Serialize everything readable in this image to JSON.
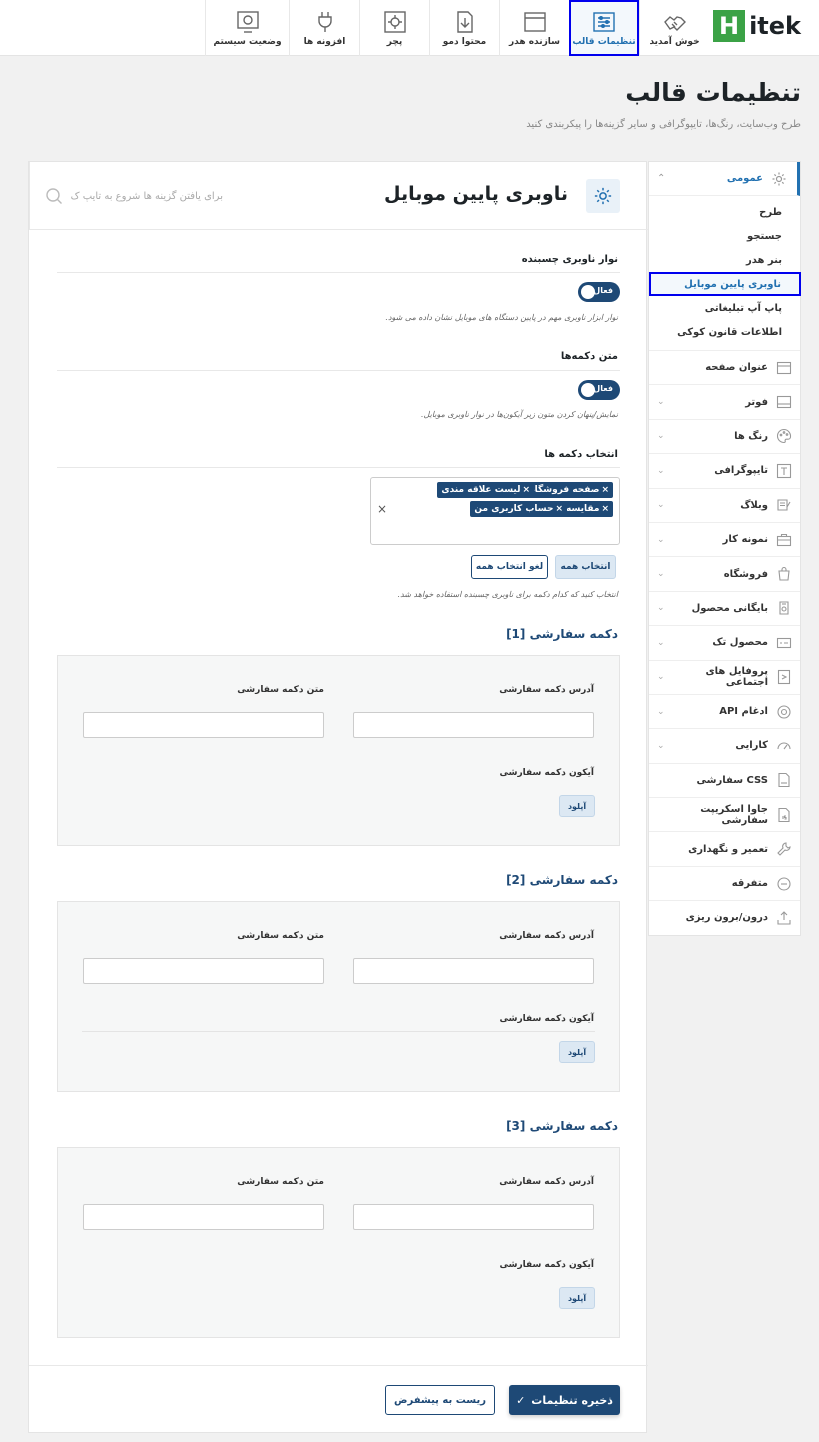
{
  "logo": {
    "letter": "H",
    "text": "itek"
  },
  "topnav": [
    {
      "label": "خوش آمدید",
      "icon": "handshake-icon"
    },
    {
      "label": "تنظیمات قالب",
      "icon": "settings-panel-icon",
      "active": true
    },
    {
      "label": "سازنده هدر",
      "icon": "header-builder-icon"
    },
    {
      "label": "محتوا دمو",
      "icon": "demo-import-icon"
    },
    {
      "label": "پچر",
      "icon": "patcher-gear-icon"
    },
    {
      "label": "افزونه ها",
      "icon": "plugin-plug-icon"
    },
    {
      "label": "وضعیت سیستم",
      "icon": "system-status-icon"
    }
  ],
  "page": {
    "title": "تنظیمات قالب",
    "subtitle": "طرح وب‌سایت، رنگ‌ها، تایپوگرافی و سایر گزینه‌ها را پیکربندی کنید"
  },
  "sidebar": {
    "general": "عمومی",
    "subitems": [
      "طرح",
      "جستجو",
      "بنر هدر",
      "ناوبری پایین موبایل",
      "پاپ آپ تبلیغاتی",
      "اطلاعات قانون کوکی"
    ],
    "active_sub": "ناوبری پایین موبایل",
    "items": [
      {
        "label": "عنوان صفحه",
        "icon": "page-title-icon",
        "chev": ""
      },
      {
        "label": "فوتر",
        "icon": "footer-icon",
        "chev": "⌄"
      },
      {
        "label": "رنگ ها",
        "icon": "palette-icon",
        "chev": "⌄"
      },
      {
        "label": "تایپوگرافی",
        "icon": "typography-icon",
        "chev": "⌄"
      },
      {
        "label": "وبلاگ",
        "icon": "blog-icon",
        "chev": "⌄"
      },
      {
        "label": "نمونه کار",
        "icon": "portfolio-icon",
        "chev": "⌄"
      },
      {
        "label": "فروشگاه",
        "icon": "shop-bag-icon",
        "chev": "⌄"
      },
      {
        "label": "بایگانی محصول",
        "icon": "product-archive-icon",
        "chev": "⌄"
      },
      {
        "label": "محصول تک",
        "icon": "single-product-icon",
        "chev": "⌄"
      },
      {
        "label": "پروفایل های اجتماعی",
        "icon": "social-profile-icon",
        "chev": "⌄"
      },
      {
        "label": "ادغام API",
        "icon": "api-icon",
        "chev": "⌄"
      },
      {
        "label": "کارایی",
        "icon": "performance-gauge-icon",
        "chev": "⌄"
      },
      {
        "label": "CSS سفارشی",
        "icon": "css-file-icon",
        "chev": ""
      },
      {
        "label": "جاوا اسکریپت سفارشی",
        "icon": "js-file-icon",
        "chev": ""
      },
      {
        "label": "تعمیر و نگهداری",
        "icon": "maintenance-icon",
        "chev": ""
      },
      {
        "label": "متفرقه",
        "icon": "misc-icon",
        "chev": ""
      },
      {
        "label": "درون/برون ریزی",
        "icon": "import-export-icon",
        "chev": ""
      }
    ]
  },
  "main": {
    "title": "ناوبری پایین موبایل",
    "search_placeholder": "برای یافتن گزینه ها شروع به تایپ ک",
    "sticky": {
      "label": "نوار ناوبری چسبنده",
      "toggle": "فعال",
      "desc": "نوار ابزار ناوبری مهم در پایین دستگاه های موبایل نشان داده می شود."
    },
    "buttons_text": {
      "label": "متن دکمه‌ها",
      "toggle": "فعال",
      "desc": "نمایش/پنهان کردن متون زیر آیکون‌ها در نوار ناوبری موبایل."
    },
    "select_buttons": {
      "label": "انتخاب دکمه ها",
      "chips": [
        "صفحه فروشگاه",
        "لیست علاقه مندی",
        "مقایسه",
        "حساب کاربری من"
      ],
      "chip_x": "×",
      "clear": "×",
      "select_all": "انتخاب همه",
      "deselect_all": "لغو انتخاب همه",
      "desc": "انتخاب کنید که کدام دکمه برای ناوبری چسبنده استفاده خواهد شد."
    },
    "custom_buttons": [
      {
        "title": "دکمه سفارشی [1]",
        "url_label": "آدرس دکمه سفارشی",
        "text_label": "متن دکمه سفارشی",
        "icon_label": "آیکون دکمه سفارشی",
        "upload": "آپلود"
      },
      {
        "title": "دکمه سفارشی [2]",
        "url_label": "آدرس دکمه سفارشی",
        "text_label": "متن دکمه سفارشی",
        "icon_label": "آیکون دکمه سفارشی",
        "upload": "آپلود"
      },
      {
        "title": "دکمه سفارشی [3]",
        "url_label": "آدرس دکمه سفارشی",
        "text_label": "متن دکمه سفارشی",
        "icon_label": "آیکون دکمه سفارشی",
        "upload": "آپلود"
      }
    ],
    "save": "ذخیره تنظیمات",
    "reset": "ریست به پیشفرض"
  },
  "colors": {
    "accent": "#1e4976",
    "brand_green": "#3ba246",
    "highlight": "#0000ee"
  }
}
